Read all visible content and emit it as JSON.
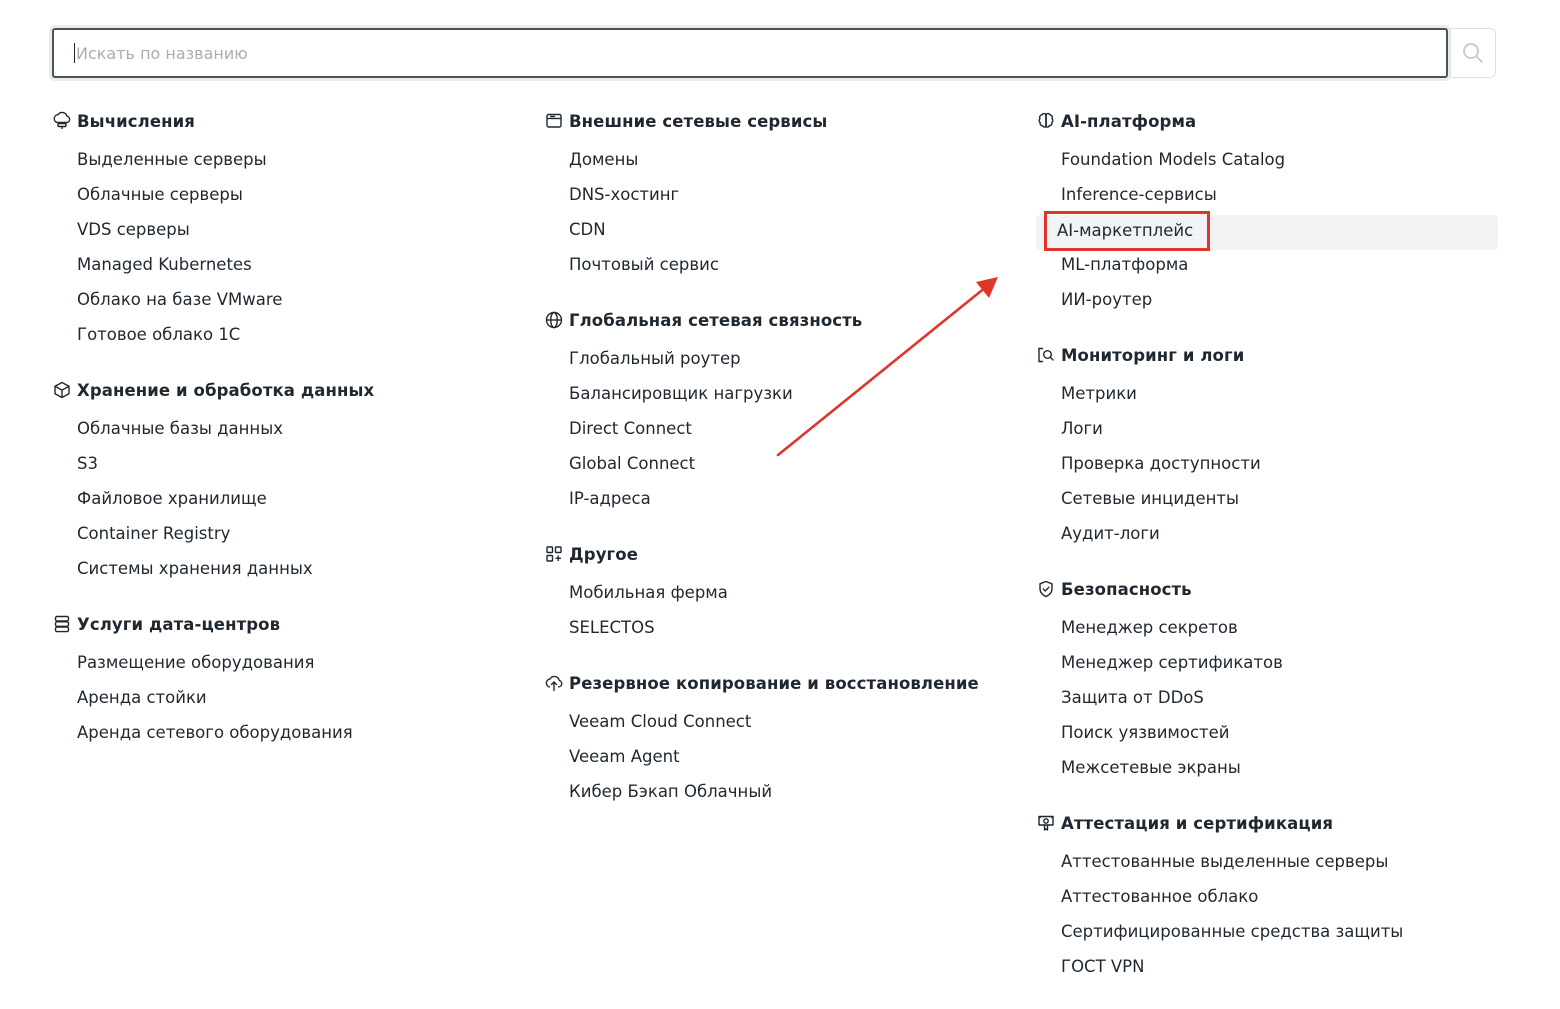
{
  "search": {
    "placeholder": "Искать по названию",
    "value": ""
  },
  "columns": [
    {
      "sections": [
        {
          "icon": "server-icon",
          "title": "Вычисления",
          "items": [
            "Выделенные серверы",
            "Облачные серверы",
            "VDS серверы",
            "Managed Kubernetes",
            "Облако на базе VMware",
            "Готовое облако 1С"
          ]
        },
        {
          "icon": "cube-icon",
          "title": "Хранение и обработка данных",
          "items": [
            "Облачные базы данных",
            "S3",
            "Файловое хранилище",
            "Container Registry",
            "Системы хранения данных"
          ]
        },
        {
          "icon": "database-icon",
          "title": "Услуги дата-центров",
          "items": [
            "Размещение оборудования",
            "Аренда стойки",
            "Аренда сетевого оборудования"
          ]
        }
      ]
    },
    {
      "sections": [
        {
          "icon": "window-icon",
          "title": "Внешние сетевые сервисы",
          "items": [
            "Домены",
            "DNS-хостинг",
            "CDN",
            "Почтовый сервис"
          ]
        },
        {
          "icon": "globe-icon",
          "title": "Глобальная сетевая связность",
          "items": [
            "Глобальный роутер",
            "Балансировщик нагрузки",
            "Direct Connect",
            "Global Connect",
            "IP-адреса"
          ]
        },
        {
          "icon": "grid-plus-icon",
          "title": "Другое",
          "items": [
            "Мобильная ферма",
            "SELECTOS"
          ]
        },
        {
          "icon": "cloud-upload-icon",
          "title": "Резервное копирование и восстановление",
          "items": [
            "Veeam Cloud Connect",
            "Veeam Agent",
            "Кибер Бэкап Облачный"
          ]
        }
      ]
    },
    {
      "sections": [
        {
          "icon": "brain-icon",
          "title": "AI-платформа",
          "items": [
            "Foundation Models Catalog",
            "Inference-сервисы",
            "AI-маркетплейс",
            "ML-платформа",
            "ИИ-роутер"
          ]
        },
        {
          "icon": "monitor-search-icon",
          "title": "Мониторинг и логи",
          "items": [
            "Метрики",
            "Логи",
            "Проверка доступности",
            "Сетевые инциденты",
            "Аудит-логи"
          ]
        },
        {
          "icon": "shield-check-icon",
          "title": "Безопасность",
          "items": [
            "Менеджер секретов",
            "Менеджер сертификатов",
            "Защита от DDoS",
            "Поиск уязвимостей",
            "Межсетевые экраны"
          ]
        },
        {
          "icon": "certificate-icon",
          "title": "Аттестация и сертификация",
          "items": [
            "Аттестованные выделенные серверы",
            "Аттестованное облако",
            "Сертифицированные средства защиты",
            "ГОСТ VPN"
          ]
        }
      ]
    }
  ],
  "annotation": {
    "highlighted_item": "AI-маркетплейс",
    "highlight_color": "#e0352b",
    "arrow_color": "#e0352b"
  },
  "colors": {
    "text": "#1f2730",
    "placeholder": "#a9aeb3",
    "border": "#4c5358",
    "hover_bg": "#f2f3f4"
  }
}
